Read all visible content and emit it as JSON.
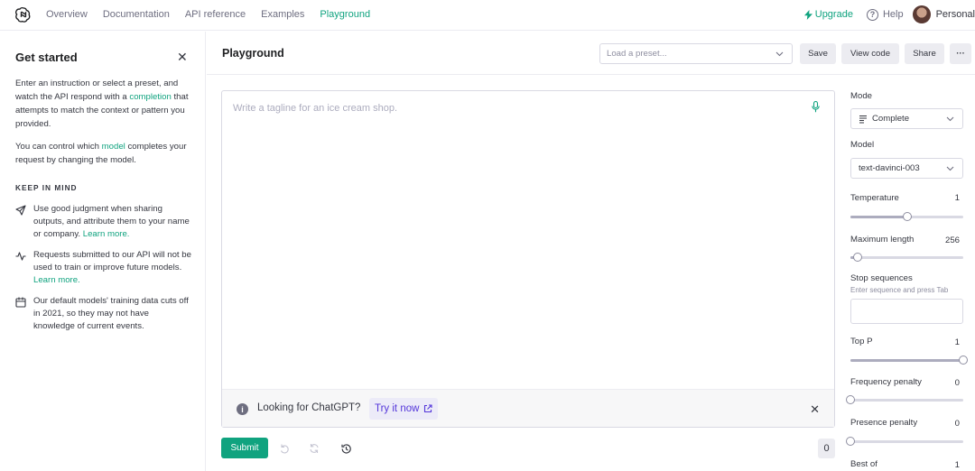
{
  "nav": {
    "links": [
      "Overview",
      "Documentation",
      "API reference",
      "Examples",
      "Playground"
    ],
    "active_index": 4,
    "upgrade": "Upgrade",
    "help": "Help",
    "account": "Personal"
  },
  "sidebar": {
    "title": "Get started",
    "p1_a": "Enter an instruction or select a preset, and watch the API respond with a ",
    "p1_link": "completion",
    "p1_b": " that attempts to match the context or pattern you provided.",
    "p2_a": "You can control which ",
    "p2_link": "model",
    "p2_b": " completes your request by changing the model.",
    "keep_heading": "KEEP IN MIND",
    "tip1": "Use good judgment when sharing outputs, and attribute them to your name or company. ",
    "tip2": "Requests submitted to our API will not be used to train or improve future models. ",
    "tip3": "Our default models' training data cuts off in 2021, so they may not have knowledge of current events.",
    "learn_more": "Learn more."
  },
  "main": {
    "title": "Playground",
    "preset_placeholder": "Load a preset...",
    "save": "Save",
    "view_code": "View code",
    "share": "Share",
    "more": "···",
    "editor_placeholder": "Write a tagline for an ice cream shop.",
    "banner_text": "Looking for ChatGPT?",
    "banner_link": "Try it now",
    "submit": "Submit",
    "token_count": "0"
  },
  "settings": {
    "mode_label": "Mode",
    "mode_value": "Complete",
    "model_label": "Model",
    "model_value": "text-davinci-003",
    "temperature_label": "Temperature",
    "temperature_value": "1",
    "temperature_level": 0.5,
    "max_length_label": "Maximum length",
    "max_length_value": "256",
    "max_length_level": 0.06,
    "stop_label": "Stop sequences",
    "stop_hint": "Enter sequence and press Tab",
    "top_p_label": "Top P",
    "top_p_value": "1",
    "top_p_level": 1.0,
    "freq_label": "Frequency penalty",
    "freq_value": "0",
    "freq_level": 0.0,
    "presence_label": "Presence penalty",
    "presence_value": "0",
    "presence_level": 0.0,
    "best_of_label": "Best of",
    "best_of_value": "1"
  },
  "colors": {
    "accent": "#10a37f",
    "link_purple": "#5436da"
  }
}
